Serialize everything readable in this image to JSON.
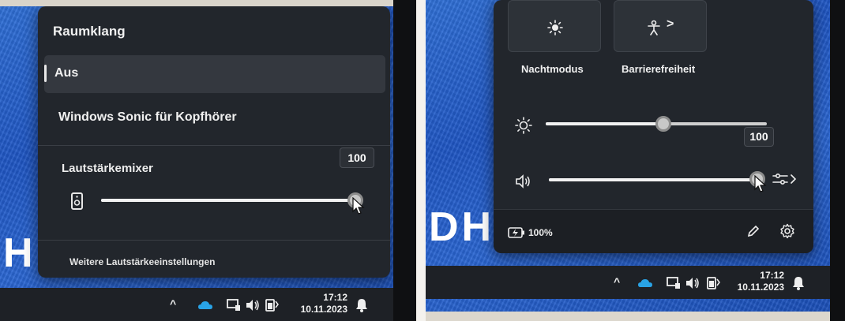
{
  "left_panel": {
    "flyout": {
      "heading": "Raumklang",
      "options": [
        {
          "label": "Aus",
          "selected": true
        },
        {
          "label": "Windows Sonic für Kopfhörer",
          "selected": false
        }
      ],
      "mixer_label": "Lautstärkemixer",
      "volume_tooltip": "100",
      "volume_level_percent": 100,
      "footer_link": "Weitere Lautstärkeeinstellungen"
    },
    "background_text": "H C",
    "taskbar": {
      "time": "17:12",
      "date": "10.11.2023"
    }
  },
  "right_panel": {
    "flyout": {
      "tiles": [
        {
          "label": "Nachtmodus",
          "icon": "night-mode-icon"
        },
        {
          "label": "Barrierefreiheit",
          "icon": "accessibility-icon",
          "chevron": ">"
        }
      ],
      "brightness_tooltip": "100",
      "brightness_level_percent": 55,
      "volume_level_percent": 100,
      "battery_label": "100%"
    },
    "background_text": "DH C",
    "taskbar": {
      "time": "17:12",
      "date": "10.11.2023"
    }
  },
  "colors": {
    "flyout_bg": "#22262c",
    "desktop_blue": "#1f56c4",
    "taskbar_bg": "#1e2126",
    "cloud_blue": "#29a3e6"
  }
}
